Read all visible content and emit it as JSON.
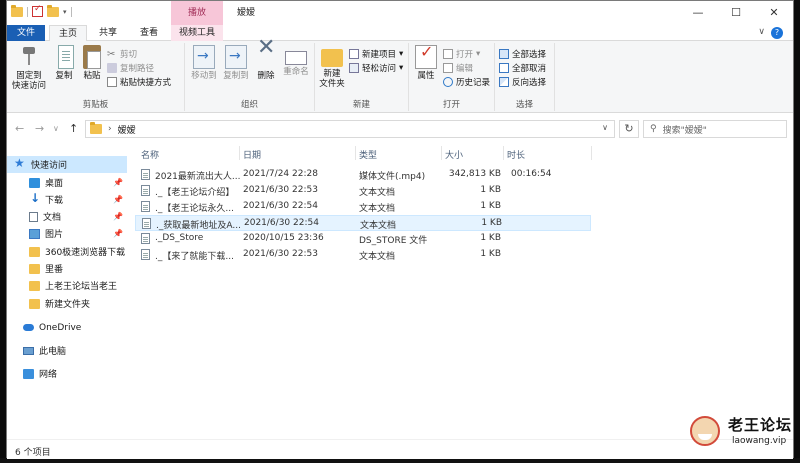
{
  "titlebar": {
    "context_tab_header": "播放",
    "title": "嫒嫒",
    "minimize": "—",
    "maximize": "☐",
    "close": "✕"
  },
  "tabs": {
    "file": "文件",
    "home": "主页",
    "share": "共享",
    "view": "查看",
    "video_tools": "视频工具"
  },
  "ribbon": {
    "clipboard": {
      "label": "剪贴板",
      "pin": "固定到\n快速访问",
      "copy": "复制",
      "paste": "粘贴",
      "cut": "剪切",
      "copy_path": "复制路径",
      "paste_shortcut": "粘贴快捷方式"
    },
    "organize": {
      "label": "组织",
      "move_to": "移动到",
      "copy_to": "复制到",
      "delete": "删除",
      "rename": "重命名"
    },
    "new": {
      "label": "新建",
      "new_folder": "新建\n文件夹",
      "new_item": "新建项目",
      "easy_access": "轻松访问"
    },
    "open": {
      "label": "打开",
      "properties": "属性",
      "open": "打开",
      "edit": "编辑",
      "history": "历史记录"
    },
    "select": {
      "label": "选择",
      "select_all": "全部选择",
      "select_none": "全部取消",
      "invert": "反向选择"
    }
  },
  "address": {
    "path": "嫒嫒",
    "search_placeholder": "搜索\"嫒嫒\""
  },
  "nav": {
    "quick_access": "快速访问",
    "items": [
      {
        "label": "桌面",
        "icon": "desktop-icon",
        "pinned": true
      },
      {
        "label": "下载",
        "icon": "download-icon",
        "pinned": true
      },
      {
        "label": "文档",
        "icon": "document-icon",
        "pinned": true
      },
      {
        "label": "图片",
        "icon": "picture-icon",
        "pinned": true
      },
      {
        "label": "360极速浏览器下载",
        "icon": "folder-icon",
        "pinned": false
      },
      {
        "label": "里番",
        "icon": "folder-icon",
        "pinned": false
      },
      {
        "label": "上老王论坛当老王",
        "icon": "folder-icon",
        "pinned": false
      },
      {
        "label": "新建文件夹",
        "icon": "folder-icon",
        "pinned": false
      }
    ],
    "onedrive": "OneDrive",
    "this_pc": "此电脑",
    "network": "网络",
    "pin_glyph": "📌"
  },
  "columns": {
    "name": "名称",
    "date": "日期",
    "type": "类型",
    "size": "大小",
    "duration": "时长"
  },
  "files": [
    {
      "name": "2021最新流出大人...",
      "date": "2021/7/24 22:28",
      "type": "媒体文件(.mp4)",
      "size": "342,813 KB",
      "duration": "00:16:54"
    },
    {
      "name": "._【老王论坛介绍】",
      "date": "2021/6/30 22:53",
      "type": "文本文档",
      "size": "1 KB",
      "duration": ""
    },
    {
      "name": "._【老王论坛永久...",
      "date": "2021/6/30 22:54",
      "type": "文本文档",
      "size": "1 KB",
      "duration": ""
    },
    {
      "name": "._获取最新地址及A...",
      "date": "2021/6/30 22:54",
      "type": "文本文档",
      "size": "1 KB",
      "duration": ""
    },
    {
      "name": "._DS_Store",
      "date": "2020/10/15 23:36",
      "type": "DS_STORE 文件",
      "size": "1 KB",
      "duration": ""
    },
    {
      "name": "._【来了就能下载...",
      "date": "2021/6/30 22:53",
      "type": "文本文档",
      "size": "1 KB",
      "duration": ""
    }
  ],
  "status": {
    "count": "6 个项目"
  },
  "watermark": {
    "title": "老王论坛",
    "sub": "laowang.vip"
  },
  "colors": {
    "accent": "#1a5fb4",
    "context_tab": "#f7c6d8",
    "selection": "#cce8ff"
  }
}
